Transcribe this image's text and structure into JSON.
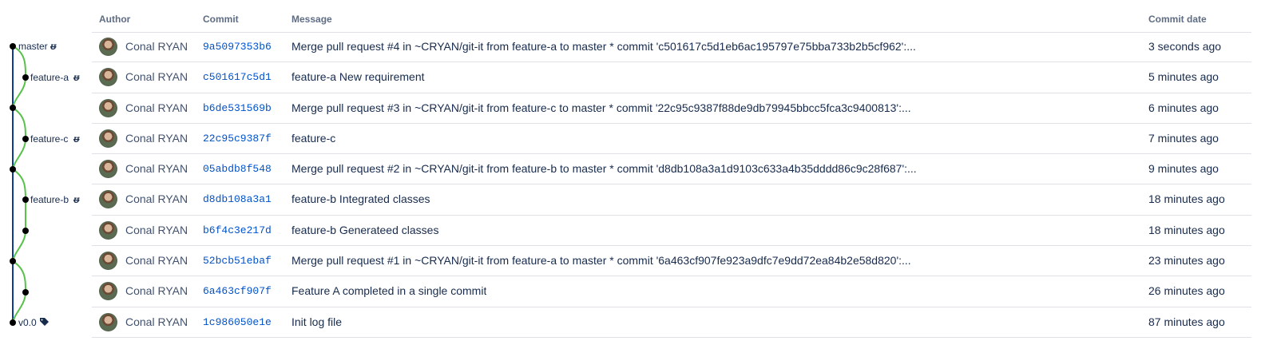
{
  "columns": {
    "author": "Author",
    "commit": "Commit",
    "message": "Message",
    "date": "Commit date"
  },
  "branch_labels": {
    "master": "master",
    "feature_a": "feature-a",
    "feature_c": "feature-c",
    "feature_b": "feature-b",
    "tag": "v0.0"
  },
  "colors": {
    "main_line": "#0b3d91",
    "branch_line": "#57c24a",
    "link": "#0052cc",
    "border": "#dfe1e6"
  },
  "commits": [
    {
      "author": "Conal RYAN",
      "hash": "9a5097353b6",
      "message": "Merge pull request #4 in ~CRYAN/git-it from feature-a to master * commit 'c501617c5d1eb6ac195797e75bba733b2b5cf962':...",
      "date": "3 seconds ago"
    },
    {
      "author": "Conal RYAN",
      "hash": "c501617c5d1",
      "message": "feature-a New requirement",
      "date": "5 minutes ago"
    },
    {
      "author": "Conal RYAN",
      "hash": "b6de531569b",
      "message": "Merge pull request #3 in ~CRYAN/git-it from feature-c to master * commit '22c95c9387f88de9db79945bbcc5fca3c9400813':...",
      "date": "6 minutes ago"
    },
    {
      "author": "Conal RYAN",
      "hash": "22c95c9387f",
      "message": "feature-c",
      "date": "7 minutes ago"
    },
    {
      "author": "Conal RYAN",
      "hash": "05abdb8f548",
      "message": "Merge pull request #2 in ~CRYAN/git-it from feature-b to master * commit 'd8db108a3a1d9103c633a4b35dddd86c9c28f687':...",
      "date": "9 minutes ago"
    },
    {
      "author": "Conal RYAN",
      "hash": "d8db108a3a1",
      "message": "feature-b Integrated classes",
      "date": "18 minutes ago"
    },
    {
      "author": "Conal RYAN",
      "hash": "b6f4c3e217d",
      "message": "feature-b Generateed classes",
      "date": "18 minutes ago"
    },
    {
      "author": "Conal RYAN",
      "hash": "52bcb51ebaf",
      "message": "Merge pull request #1 in ~CRYAN/git-it from feature-a to master * commit '6a463cf907fe923a9dfc7e9dd72ea84b2e58d820':...",
      "date": "23 minutes ago"
    },
    {
      "author": "Conal RYAN",
      "hash": "6a463cf907f",
      "message": "Feature A completed in a single commit",
      "date": "26 minutes ago"
    },
    {
      "author": "Conal RYAN",
      "hash": "1c986050e1e",
      "message": "Init log file",
      "date": "87 minutes ago"
    }
  ]
}
